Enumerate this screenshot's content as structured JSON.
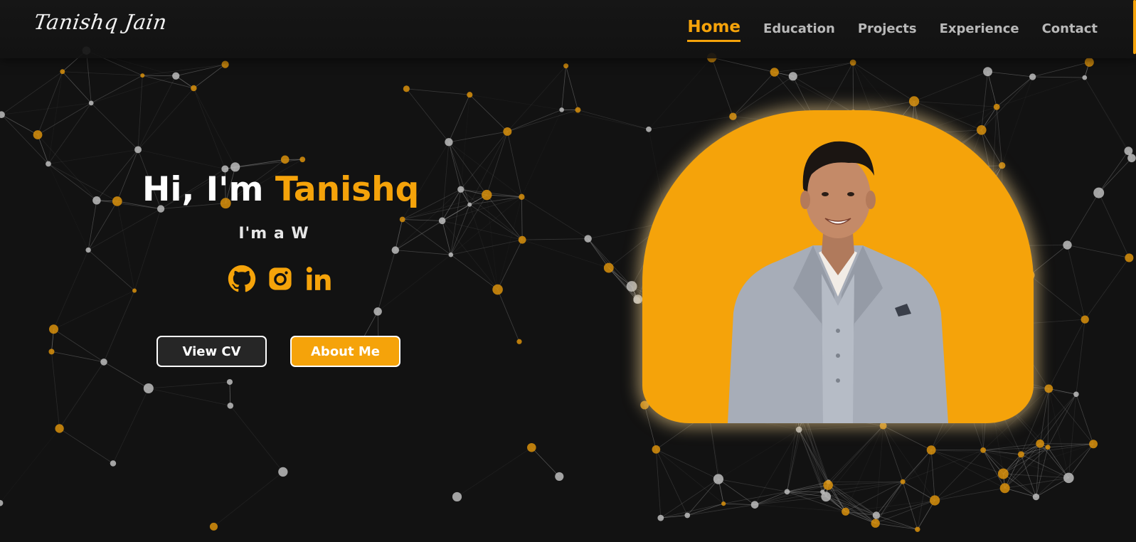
{
  "brand": {
    "logo_text": "Tanishq Jain"
  },
  "nav": {
    "items": [
      {
        "label": "Home",
        "active": true
      },
      {
        "label": "Education",
        "active": false
      },
      {
        "label": "Projects",
        "active": false
      },
      {
        "label": "Experience",
        "active": false
      },
      {
        "label": "Contact",
        "active": false
      }
    ]
  },
  "hero": {
    "greeting": "Hi, I'm",
    "name": "Tanishq",
    "typing_text": "I'm a W"
  },
  "socials": [
    {
      "icon": "github-icon",
      "label": "GitHub"
    },
    {
      "icon": "instagram-icon",
      "label": "Instagram"
    },
    {
      "icon": "linkedin-icon",
      "label": "LinkedIn"
    }
  ],
  "buttons": {
    "view_cv": "View CV",
    "about_me": "About Me"
  },
  "colors": {
    "accent": "#f5a30a",
    "background": "#121212",
    "node_grey": "#bdbdbd",
    "node_orange": "#d9900c"
  }
}
